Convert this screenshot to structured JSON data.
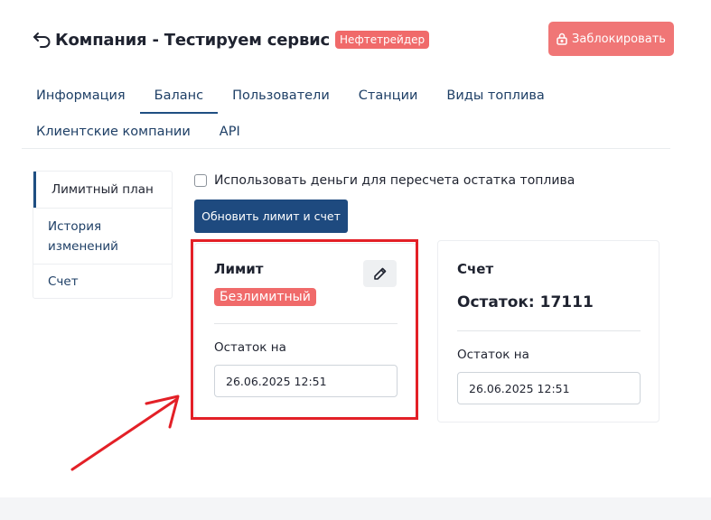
{
  "header": {
    "back_icon": "arrow-back-icon",
    "title": "Компания - Тестируем сервис",
    "org_badge": "Нефтетрейдер",
    "block_button_label": "Заблокировать",
    "block_button_icon": "lock-icon",
    "block_button_color": "#f07676"
  },
  "tabs": [
    {
      "label": "Информация",
      "active": false
    },
    {
      "label": "Баланс",
      "active": true
    },
    {
      "label": "Пользователи",
      "active": false
    },
    {
      "label": "Станции",
      "active": false
    },
    {
      "label": "Виды топлива",
      "active": false
    },
    {
      "label": "Клиентские компании",
      "active": false
    },
    {
      "label": "API",
      "active": false
    }
  ],
  "side_menu": {
    "items": [
      {
        "label": "Лимитный план",
        "active": true
      },
      {
        "label": "История изменений",
        "active": false
      },
      {
        "label": "Счет",
        "active": false
      }
    ]
  },
  "main": {
    "use_money_checkbox": {
      "label": "Использовать деньги для пересчета остатка топлива",
      "checked": false
    },
    "update_button_label": "Обновить лимит и счет",
    "limit_card": {
      "title": "Лимит",
      "badge": "Безлимитный",
      "edit_icon": "pencil-icon",
      "balance_label": "Остаток на",
      "date_value": "26.06.2025 12:51"
    },
    "account_card": {
      "title": "Счет",
      "balance_text": "Остаток: 17111",
      "balance_label": "Остаток на",
      "date_value": "26.06.2025 12:51"
    }
  },
  "annotation": {
    "color": "#e32027"
  },
  "colors": {
    "primary": "#1e4a7f",
    "danger": "#f06a6a",
    "text": "#1f2330",
    "link": "#1e3f66"
  }
}
